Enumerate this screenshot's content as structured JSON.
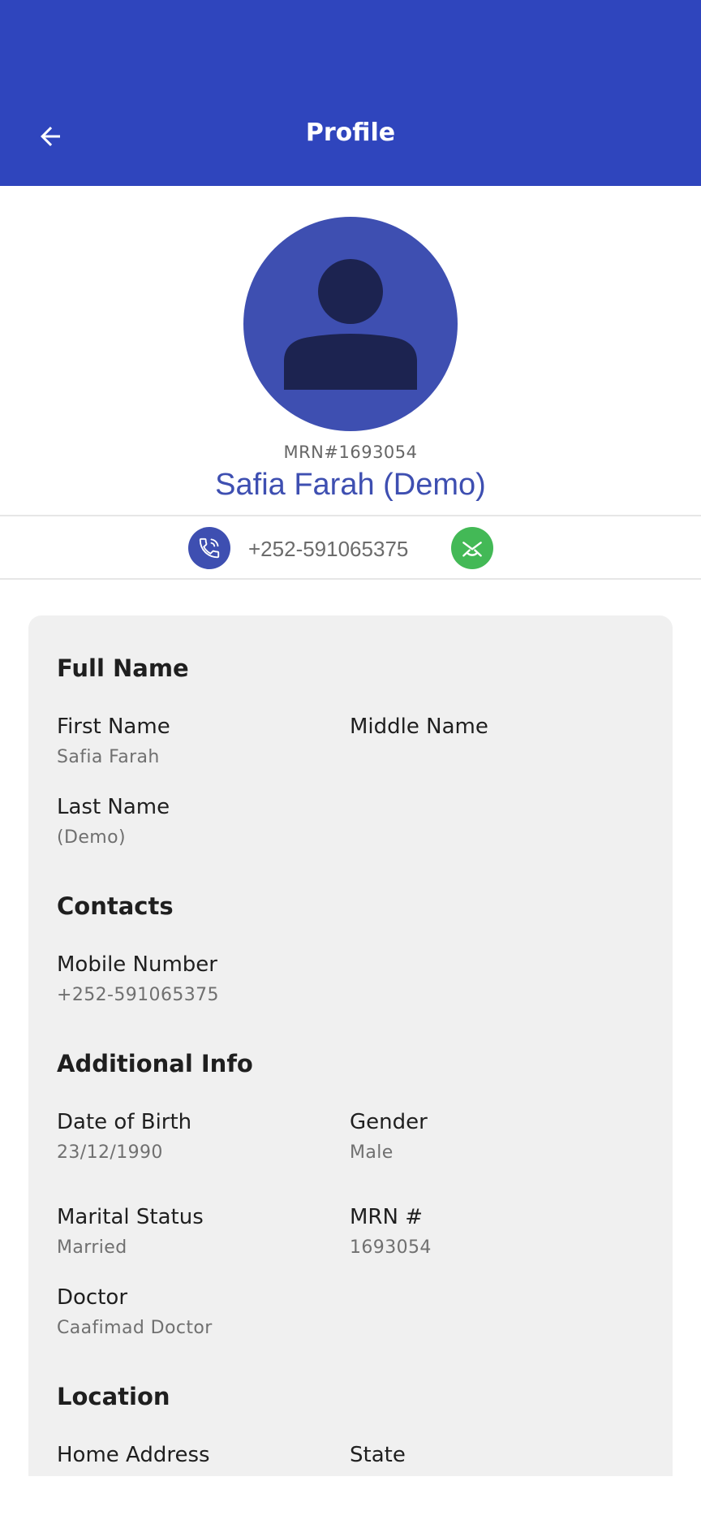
{
  "header": {
    "title": "Profile",
    "back_icon": "arrow-left-icon",
    "background": "#2f45bd"
  },
  "profile": {
    "avatar_icon": "person-icon",
    "mrn_line": "MRN#1693054",
    "name": "Safia Farah (Demo)",
    "phone": "+252-591065375",
    "call_icon": "phone-call-icon",
    "whatsapp_icon": "whatsapp-icon",
    "accent_color": "#3e4fb1",
    "whatsapp_color": "#43b956"
  },
  "sections": {
    "full_name": {
      "title": "Full Name",
      "first_name_label": "First Name",
      "first_name_value": "Safia Farah",
      "middle_name_label": "Middle Name",
      "last_name_label": "Last Name",
      "last_name_value": "(Demo)"
    },
    "contacts": {
      "title": "Contacts",
      "mobile_label": "Mobile Number",
      "mobile_value": "+252-591065375"
    },
    "additional_info": {
      "title": "Additional Info",
      "dob_label": "Date of Birth",
      "dob_value": "23/12/1990",
      "gender_label": "Gender",
      "gender_value": "Male",
      "marital_label": "Marital Status",
      "marital_value": "Married",
      "mrn_label": "MRN #",
      "mrn_value": "1693054",
      "doctor_label": "Doctor",
      "doctor_value": "Caafimad Doctor"
    },
    "location": {
      "title": "Location",
      "home_address_label": "Home Address",
      "state_label": "State"
    }
  }
}
